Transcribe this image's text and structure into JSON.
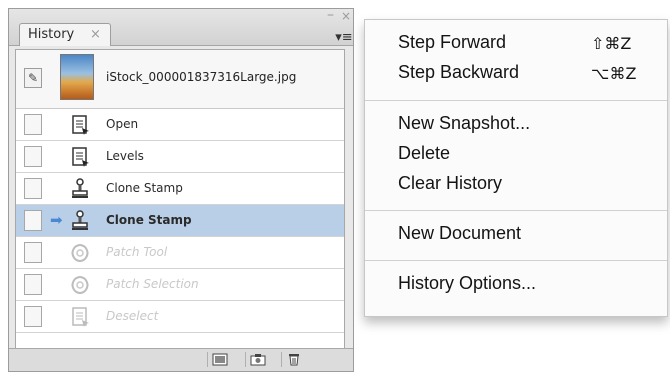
{
  "panel": {
    "tab_label": "History",
    "tab_close": "×",
    "window_minimize": "–",
    "window_close": "×",
    "panel_menu_glyph": "▾≡",
    "snapshot": {
      "filename": "iStock_000001837316Large.jpg",
      "brush_glyph": "✎"
    },
    "steps": [
      {
        "label": "Open",
        "icon": "document-icon",
        "state": "normal"
      },
      {
        "label": "Levels",
        "icon": "document-icon",
        "state": "normal"
      },
      {
        "label": "Clone Stamp",
        "icon": "clone-stamp-icon",
        "state": "normal"
      },
      {
        "label": "Clone Stamp",
        "icon": "clone-stamp-icon",
        "state": "current"
      },
      {
        "label": "Patch Tool",
        "icon": "patch-icon",
        "state": "undone"
      },
      {
        "label": "Patch Selection",
        "icon": "patch-icon",
        "state": "undone"
      },
      {
        "label": "Deselect",
        "icon": "document-icon",
        "state": "undone"
      }
    ],
    "history_state_arrow": "➡",
    "footer_buttons": [
      "new-document-from-state-icon",
      "new-snapshot-icon",
      "trash-icon"
    ]
  },
  "menu": {
    "items": [
      {
        "label": "Step Forward",
        "shortcut": "⇧⌘Z"
      },
      {
        "label": "Step Backward",
        "shortcut": "⌥⌘Z"
      },
      {
        "label": "New Snapshot...",
        "shortcut": ""
      },
      {
        "label": "Delete",
        "shortcut": ""
      },
      {
        "label": "Clear History",
        "shortcut": ""
      },
      {
        "label": "New Document",
        "shortcut": ""
      },
      {
        "label": "History Options...",
        "shortcut": ""
      }
    ]
  },
  "colors": {
    "selected_row": "#b9cfe8",
    "arrow": "#4a88d4",
    "dim_text": "#c8c8c8"
  }
}
